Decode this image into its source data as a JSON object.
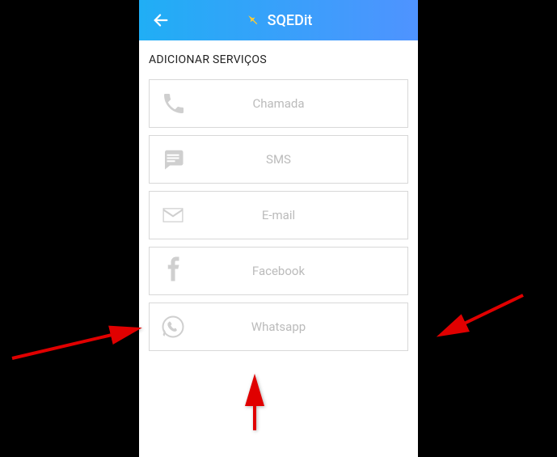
{
  "header": {
    "title": "SQEDit"
  },
  "section": {
    "heading": "ADICIONAR SERVIÇOS"
  },
  "services": [
    {
      "label": "Chamada"
    },
    {
      "label": "SMS"
    },
    {
      "label": "E-mail"
    },
    {
      "label": "Facebook"
    },
    {
      "label": "Whatsapp"
    }
  ]
}
